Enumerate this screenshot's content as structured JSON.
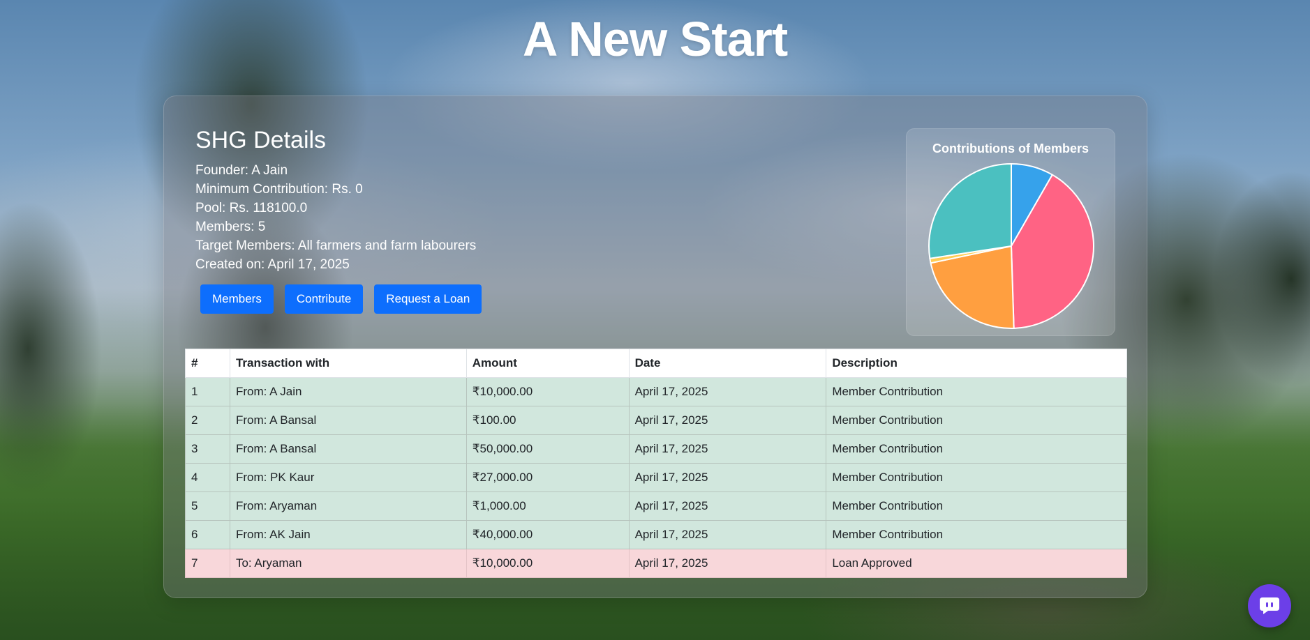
{
  "page": {
    "title": "A New Start"
  },
  "details": {
    "heading": "SHG Details",
    "founder": "Founder: A Jain",
    "min_contribution": "Minimum Contribution: Rs. 0",
    "pool": "Pool: Rs. 118100.0",
    "members": "Members: 5",
    "target_members": "Target Members: All farmers and farm labourers",
    "created_on": "Created on: April 17, 2025"
  },
  "buttons": {
    "members": "Members",
    "contribute": "Contribute",
    "request_loan": "Request a Loan"
  },
  "chart_data": {
    "type": "pie",
    "title": "Contributions of Members",
    "slices": [
      {
        "value": 8.3,
        "color": "#36a2eb"
      },
      {
        "value": 41.2,
        "color": "#ff6384"
      },
      {
        "value": 22.2,
        "color": "#ff9f40"
      },
      {
        "value": 0.9,
        "color": "#ffcd56"
      },
      {
        "value": 27.4,
        "color": "#4bc0c0"
      }
    ]
  },
  "table": {
    "headers": [
      "#",
      "Transaction with",
      "Amount",
      "Date",
      "Description"
    ],
    "rows": [
      {
        "type": "credit",
        "cells": [
          "1",
          "From: A Jain",
          "₹10,000.00",
          "April 17, 2025",
          "Member Contribution"
        ]
      },
      {
        "type": "credit",
        "cells": [
          "2",
          "From: A Bansal",
          "₹100.00",
          "April 17, 2025",
          "Member Contribution"
        ]
      },
      {
        "type": "credit",
        "cells": [
          "3",
          "From: A Bansal",
          "₹50,000.00",
          "April 17, 2025",
          "Member Contribution"
        ]
      },
      {
        "type": "credit",
        "cells": [
          "4",
          "From: PK Kaur",
          "₹27,000.00",
          "April 17, 2025",
          "Member Contribution"
        ]
      },
      {
        "type": "credit",
        "cells": [
          "5",
          "From: Aryaman",
          "₹1,000.00",
          "April 17, 2025",
          "Member Contribution"
        ]
      },
      {
        "type": "credit",
        "cells": [
          "6",
          "From: AK Jain",
          "₹40,000.00",
          "April 17, 2025",
          "Member Contribution"
        ]
      },
      {
        "type": "debit",
        "cells": [
          "7",
          "To: Aryaman",
          "₹10,000.00",
          "April 17, 2025",
          "Loan Approved"
        ]
      }
    ]
  },
  "chat": {
    "icon": "chat-bubble-icon",
    "color": "#6c3fe8"
  }
}
